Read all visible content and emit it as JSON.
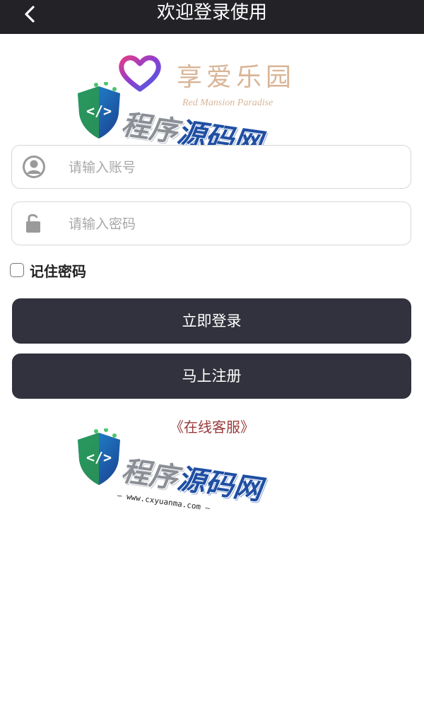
{
  "header": {
    "title": "欢迎登录使用"
  },
  "logo": {
    "name": "享爱乐园",
    "subtitle": "Red Mansion Paradise"
  },
  "watermark": {
    "text_part1": "程序",
    "text_part2": "源码网",
    "url": "— www.cxyuanma.com —"
  },
  "login_form": {
    "account_placeholder": "请输入账号",
    "password_placeholder": "请输入密码",
    "remember_label": "记住密码",
    "login_button": "立即登录",
    "register_button": "马上注册",
    "service_link": "《在线客服》"
  },
  "colors": {
    "header_bg": "#222227",
    "button_bg": "#32323e",
    "logo_accent": "#d9b596",
    "service_link": "#9a3a3a"
  }
}
